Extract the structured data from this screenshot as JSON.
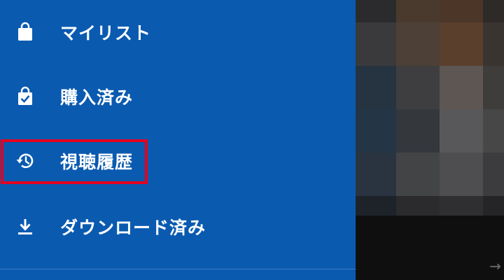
{
  "menu": {
    "items": [
      {
        "label": "マイリスト",
        "icon": "shopping-bag-icon"
      },
      {
        "label": "購入済み",
        "icon": "bag-check-icon"
      },
      {
        "label": "視聴履歴",
        "icon": "history-icon"
      },
      {
        "label": "ダウンロード済み",
        "icon": "download-icon"
      }
    ],
    "highlighted_index": 2
  },
  "colors": {
    "drawer_bg": "#0a5ab0",
    "text": "#ffffff",
    "highlight": "#e4001f",
    "video_bg": "#0f0f10"
  },
  "video": {
    "content": "pixelated-video-thumbnail"
  }
}
